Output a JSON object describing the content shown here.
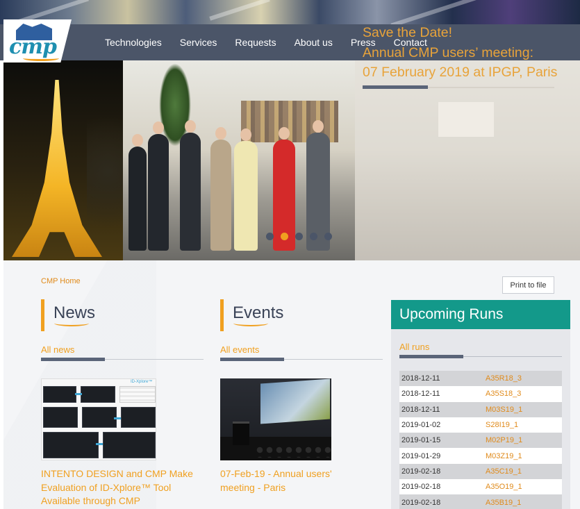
{
  "nav": {
    "logo_text": "cmp",
    "items": [
      "Technologies",
      "Services",
      "Requests",
      "About us",
      "Press",
      "Contact"
    ]
  },
  "hero": {
    "caption_lines": [
      "Save the Date!",
      "Annual CMP users’ meeting:",
      "07 February 2019 at IPGP, Paris"
    ],
    "slides_count": 5,
    "active_slide": 2
  },
  "breadcrumb": "CMP Home",
  "print_button": "Print to file",
  "news": {
    "title": "News",
    "all_link": "All news",
    "item_caption": "INTENTO DESIGN and CMP Make Evaluation of ID-Xplore™ Tool Available through CMP",
    "thumb_brand": "ID-Xplore™"
  },
  "events": {
    "title": "Events",
    "all_link": "All events",
    "item_caption": "07-Feb-19 - Annual users' meeting - Paris"
  },
  "runs": {
    "title": "Upcoming Runs",
    "all_link": "All runs",
    "rows": [
      {
        "date": "2018-12-11",
        "id": "A35R18_3"
      },
      {
        "date": "2018-12-11",
        "id": "A35S18_3"
      },
      {
        "date": "2018-12-11",
        "id": "M03S19_1"
      },
      {
        "date": "2019-01-02",
        "id": "S28I19_1"
      },
      {
        "date": "2019-01-15",
        "id": "M02P19_1"
      },
      {
        "date": "2019-01-29",
        "id": "M03Z19_1"
      },
      {
        "date": "2019-02-18",
        "id": "A35C19_1"
      },
      {
        "date": "2019-02-18",
        "id": "A35O19_1"
      },
      {
        "date": "2019-02-18",
        "id": "A35B19_1"
      }
    ]
  },
  "colors": {
    "accent": "#f0a020",
    "nav_bg": "#4b5568",
    "runs_header": "#13998a"
  }
}
